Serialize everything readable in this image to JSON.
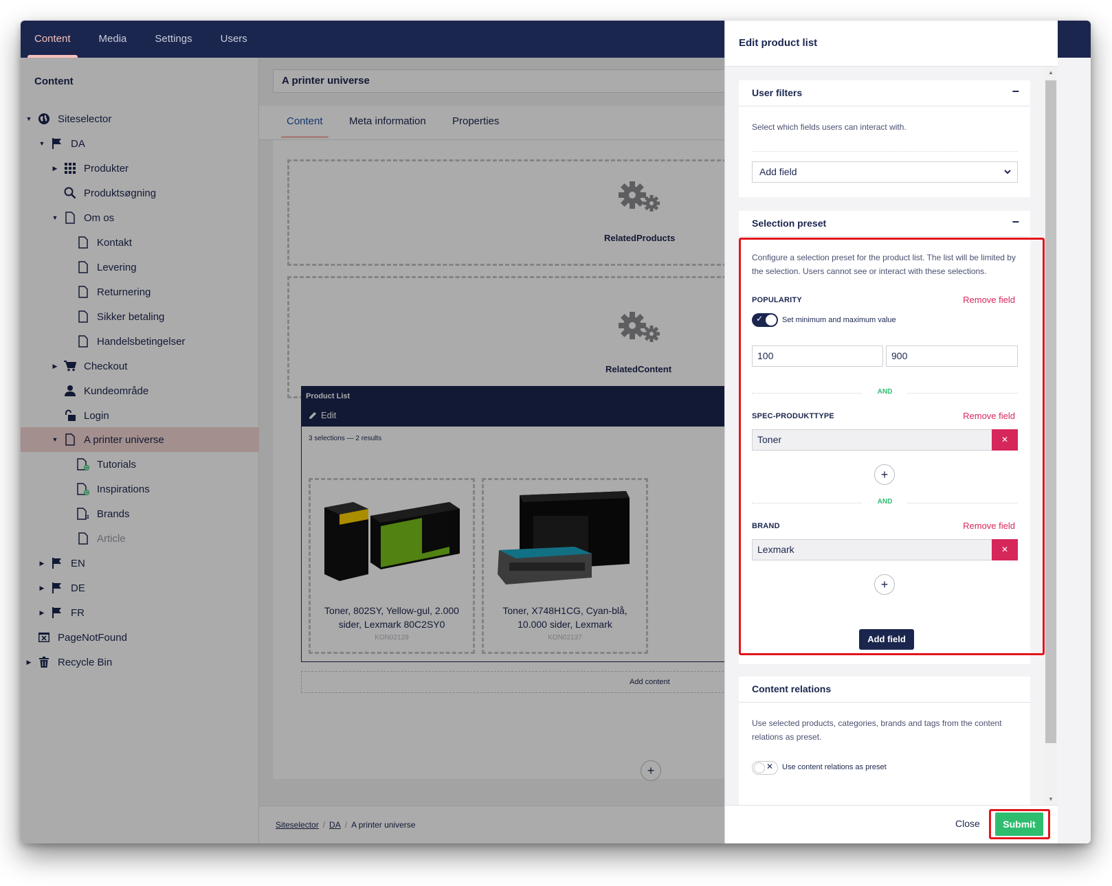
{
  "topnav": {
    "tabs": [
      {
        "label": "Content",
        "active": true
      },
      {
        "label": "Media",
        "active": false
      },
      {
        "label": "Settings",
        "active": false
      },
      {
        "label": "Users",
        "active": false
      }
    ]
  },
  "sidebar": {
    "title": "Content",
    "items": [
      {
        "label": "Siteselector",
        "icon": "globe-icon"
      },
      {
        "label": "DA",
        "icon": "flag-icon"
      },
      {
        "label": "Produkter",
        "icon": "grid-icon"
      },
      {
        "label": "Produktsøgning",
        "icon": "search-icon"
      },
      {
        "label": "Om os",
        "icon": "page-icon"
      },
      {
        "label": "Kontakt",
        "icon": "page-icon"
      },
      {
        "label": "Levering",
        "icon": "page-icon"
      },
      {
        "label": "Returnering",
        "icon": "page-icon"
      },
      {
        "label": "Sikker betaling",
        "icon": "page-icon"
      },
      {
        "label": "Handelsbetingelser",
        "icon": "page-icon"
      },
      {
        "label": "Checkout",
        "icon": "cart-icon"
      },
      {
        "label": "Kundeområde",
        "icon": "user-icon"
      },
      {
        "label": "Login",
        "icon": "lock-icon"
      },
      {
        "label": "A printer universe",
        "icon": "page-icon"
      },
      {
        "label": "Tutorials",
        "icon": "page-add-icon"
      },
      {
        "label": "Inspirations",
        "icon": "page-add-icon"
      },
      {
        "label": "Brands",
        "icon": "page-grid-icon"
      },
      {
        "label": "Article",
        "icon": "page-icon"
      },
      {
        "label": "EN",
        "icon": "flag-icon"
      },
      {
        "label": "DE",
        "icon": "flag-icon"
      },
      {
        "label": "FR",
        "icon": "flag-icon"
      },
      {
        "label": "PageNotFound",
        "icon": "notfound-icon"
      },
      {
        "label": "Recycle Bin",
        "icon": "trash-icon"
      }
    ]
  },
  "main": {
    "page_title": "A printer universe",
    "tabs": [
      "Content",
      "Meta information",
      "Properties"
    ],
    "blocks": [
      "RelatedProducts",
      "RelatedContent"
    ],
    "product_list": {
      "title": "Product List",
      "edit_label": "Edit",
      "meta": "3 selections — 2 results",
      "products": [
        {
          "name": "Toner, 802SY, Yellow-gul, 2.000 sider, Lexmark 80C2SY0",
          "sku": "KON02129"
        },
        {
          "name": "Toner, X748H1CG, Cyan-blå, 10.000 sider, Lexmark",
          "sku": "KON02137"
        }
      ]
    },
    "add_content": "Add content",
    "breadcrumb": [
      "Siteselector",
      "DA",
      "A printer universe"
    ]
  },
  "panel": {
    "title": "Edit product list",
    "user_filters": {
      "title": "User filters",
      "collapse": "−",
      "description": "Select which fields users can interact with.",
      "add_field": "Add field"
    },
    "selection_preset": {
      "title": "Selection preset",
      "collapse": "−",
      "description": "Configure a selection preset for the product list. The list will be limited by the selection. Users cannot see or interact with these selections.",
      "remove_label": "Remove field",
      "and_label": "AND",
      "popularity": {
        "label": "POPULARITY",
        "toggle_label": "Set minimum and maximum value",
        "min": "100",
        "max": "900"
      },
      "spec": {
        "label": "SPEC-PRODUKTTYPE",
        "value": "Toner"
      },
      "brand": {
        "label": "BRAND",
        "value": "Lexmark"
      },
      "add_field_button": "Add field"
    },
    "content_relations": {
      "title": "Content relations",
      "description": "Use selected products, categories, brands and tags from the content relations as preset.",
      "toggle_label": "Use content relations as preset"
    },
    "close_label": "Close",
    "submit_label": "Submit"
  },
  "colors": {
    "navy": "#1b264f",
    "accent_pink": "#f5c1bc",
    "danger": "#d6275a",
    "success": "#2ebd6e",
    "highlight_red": "#e3141c"
  }
}
